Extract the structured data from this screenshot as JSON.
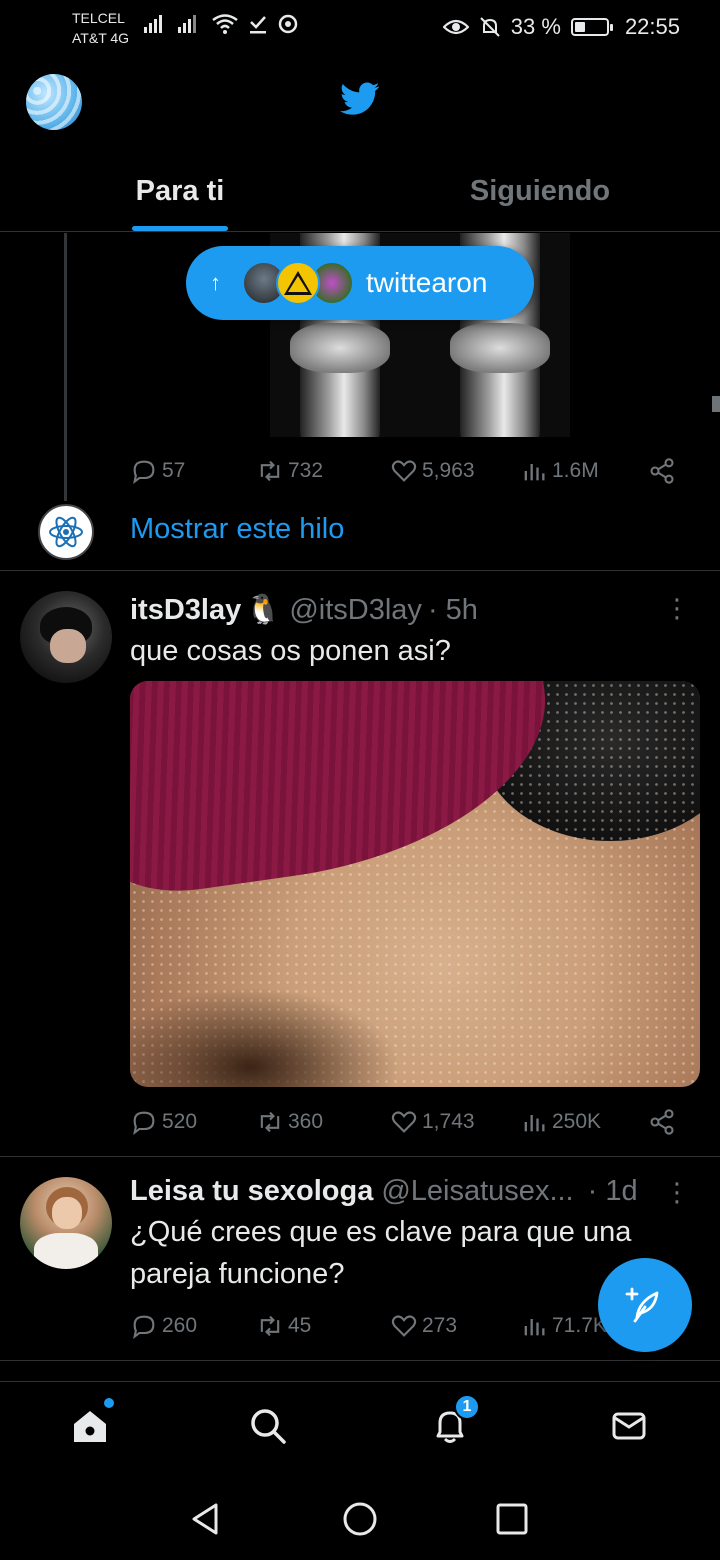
{
  "status_bar": {
    "carrier_1": "TELCEL",
    "carrier_2": "AT&T 4G",
    "battery_pct": "33 %",
    "battery_level": 0.33,
    "time": "22:55",
    "icons": [
      "signal-icon",
      "signal-icon",
      "wifi-icon",
      "download-done-icon",
      "sync-icon",
      "eye-comfort-icon",
      "bell-off-icon",
      "battery-icon"
    ]
  },
  "header": {
    "logo": "twitter-bird-icon",
    "tabs": [
      {
        "label": "Para ti",
        "active": true
      },
      {
        "label": "Siguiendo",
        "active": false
      }
    ]
  },
  "new_tweets_pill": {
    "text": "twittearon",
    "arrow": "↑"
  },
  "tweets": [
    {
      "id": "thread-tweet",
      "stats": {
        "replies": "57",
        "retweets": "732",
        "likes": "5,963",
        "views": "1.6M"
      },
      "show_thread": "Mostrar este hilo"
    },
    {
      "id": "tweet-itsd3lay",
      "name": "itsD3lay",
      "emoji": "🐧",
      "handle": "@itsD3lay",
      "time": "· 5h",
      "text": "que cosas os ponen asi?",
      "stats": {
        "replies": "520",
        "retweets": "360",
        "likes": "1,743",
        "views": "250K"
      }
    },
    {
      "id": "tweet-leisa",
      "name": "Leisa tu sexologa",
      "handle": "@Leisatusex...",
      "time": "· 1d",
      "text": "¿Qué crees que es clave para que una pareja funcione?",
      "stats": {
        "replies": "260",
        "retweets": "45",
        "likes": "273",
        "views": "71.7K"
      }
    }
  ],
  "bottom_nav": {
    "notifications_badge": "1"
  },
  "colors": {
    "accent": "#1d9bf0",
    "background": "#000000",
    "text": "#e7e9ea",
    "muted": "#71767b",
    "divider": "#2f3336"
  }
}
